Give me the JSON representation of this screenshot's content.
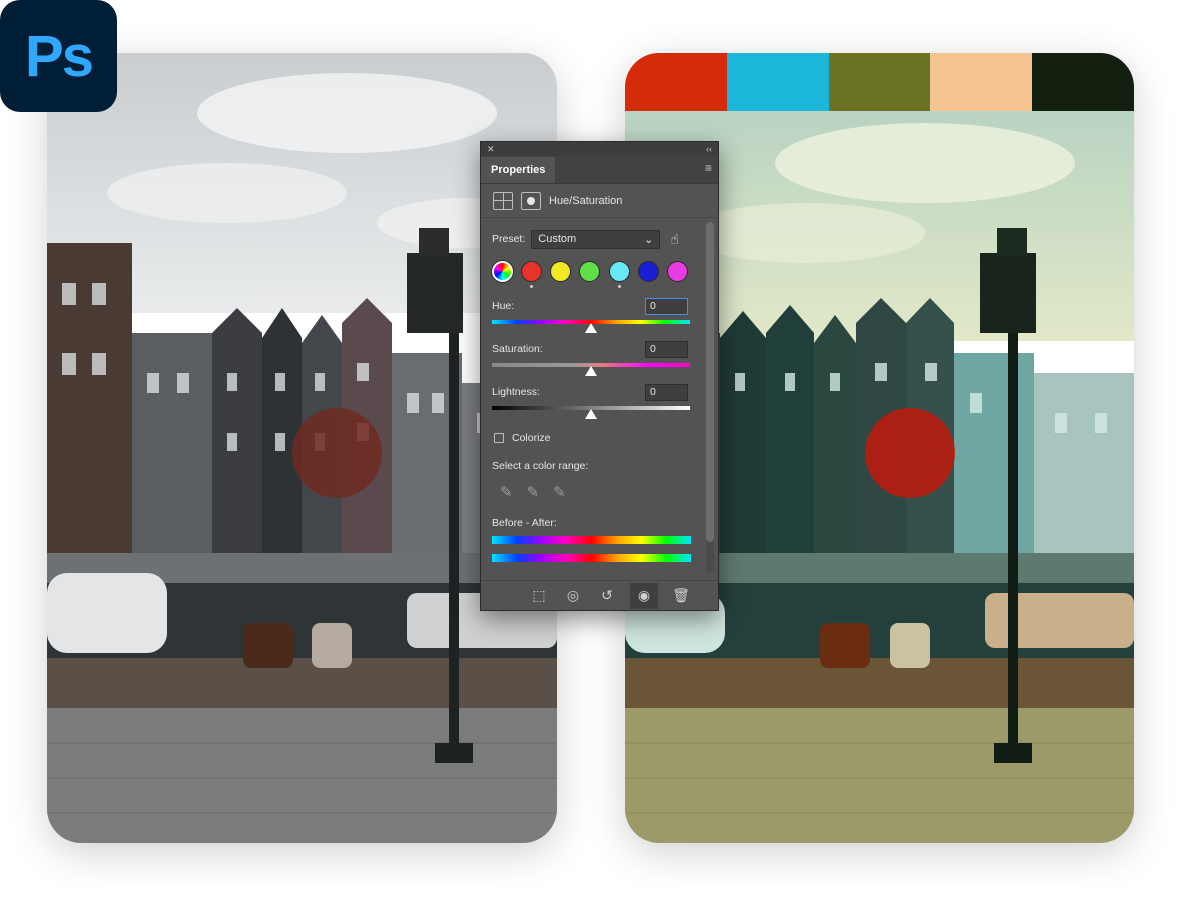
{
  "app": {
    "logo_text": "Ps"
  },
  "palette": [
    "#d42c0a",
    "#1cb7d8",
    "#6b7323",
    "#f6c393",
    "#14200f"
  ],
  "panel": {
    "title": "Properties",
    "adjustment_name": "Hue/Saturation",
    "preset_label": "Preset:",
    "preset_value": "Custom",
    "color_ranges": [
      {
        "name": "master",
        "color": "conic"
      },
      {
        "name": "reds",
        "color": "#e8332b"
      },
      {
        "name": "yellows",
        "color": "#f4e826"
      },
      {
        "name": "greens",
        "color": "#5fe04a"
      },
      {
        "name": "cyans",
        "color": "#67e8f5"
      },
      {
        "name": "blues",
        "color": "#1a1fd6"
      },
      {
        "name": "magentas",
        "color": "#e83be2"
      }
    ],
    "hue_label": "Hue:",
    "hue_value": "0",
    "saturation_label": "Saturation:",
    "saturation_value": "0",
    "lightness_label": "Lightness:",
    "lightness_value": "0",
    "colorize_label": "Colorize",
    "color_range_label": "Select a color range:",
    "before_after_label": "Before - After:"
  }
}
